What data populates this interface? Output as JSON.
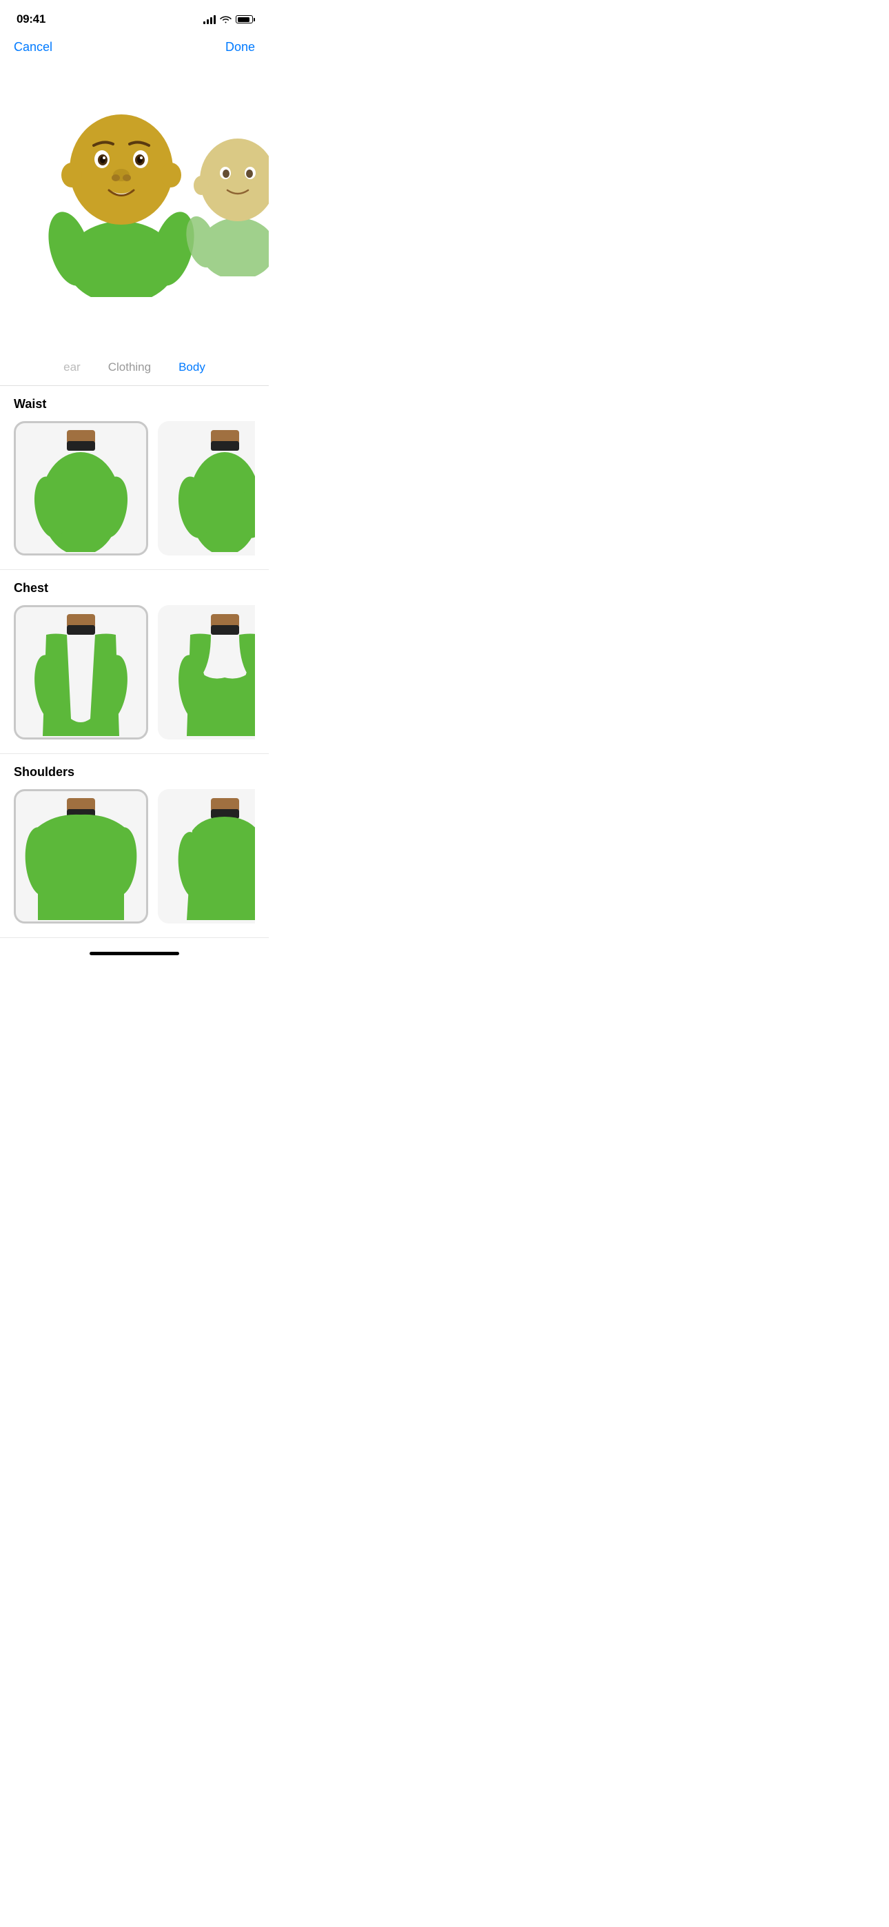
{
  "statusBar": {
    "time": "09:41",
    "signal": "full",
    "wifi": true,
    "battery": 85
  },
  "navigation": {
    "cancel_label": "Cancel",
    "done_label": "Done"
  },
  "tabs": [
    {
      "id": "headwear",
      "label": "ear",
      "active": false,
      "partial": true
    },
    {
      "id": "clothing",
      "label": "Clothing",
      "active": false
    },
    {
      "id": "body",
      "label": "Body",
      "active": true
    }
  ],
  "sections": [
    {
      "id": "waist",
      "title": "Waist",
      "options": [
        {
          "id": "waist-1",
          "selected": true
        },
        {
          "id": "waist-2",
          "selected": false
        },
        {
          "id": "waist-3",
          "selected": false
        }
      ]
    },
    {
      "id": "chest",
      "title": "Chest",
      "options": [
        {
          "id": "chest-1",
          "selected": true
        },
        {
          "id": "chest-2",
          "selected": false
        },
        {
          "id": "chest-3",
          "selected": false
        }
      ]
    },
    {
      "id": "shoulders",
      "title": "Shoulders",
      "options": [
        {
          "id": "shoulders-1",
          "selected": true
        },
        {
          "id": "shoulders-2",
          "selected": false
        },
        {
          "id": "shoulders-3",
          "selected": false
        }
      ]
    }
  ],
  "colors": {
    "accent": "#007AFF",
    "bodyGreen": "#5cb83a",
    "bodyGreenDark": "#4aa32e",
    "neckBrown": "#a07040",
    "neckBlack": "#222222",
    "skinGold": "#c9a227",
    "selected_border": "#c8c8c8"
  },
  "homeIndicator": {
    "visible": true
  }
}
